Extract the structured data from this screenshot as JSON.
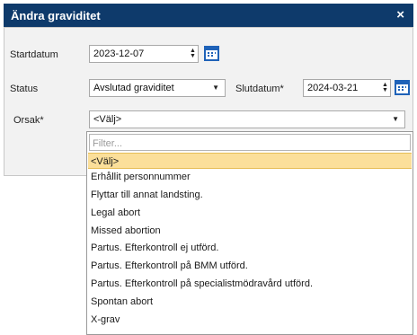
{
  "dialog": {
    "title": "Ändra graviditet",
    "close_symbol": "×"
  },
  "form": {
    "start_label": "Startdatum",
    "start_value": "2023-12-07",
    "status_label": "Status",
    "status_value": "Avslutad graviditet",
    "end_label": "Slutdatum*",
    "end_value": "2024-03-21",
    "cause_label": "Orsak*",
    "cause_value": "<Välj>"
  },
  "dropdown": {
    "filter_placeholder": "Filter...",
    "options": [
      "<Välj>",
      "Erhållit personnummer",
      "Flyttar till annat landsting.",
      "Legal abort",
      "Missed abortion",
      "Partus. Efterkontroll ej utförd.",
      "Partus. Efterkontroll på BMM utförd.",
      "Partus. Efterkontroll på specialistmödravård utförd.",
      "Spontan abort",
      "X-grav"
    ],
    "selected_option": "<Välj>"
  },
  "colors": {
    "title_bar": "#0e3a6b",
    "highlight": "#fbdf9a",
    "icon": "#1f62b8"
  }
}
